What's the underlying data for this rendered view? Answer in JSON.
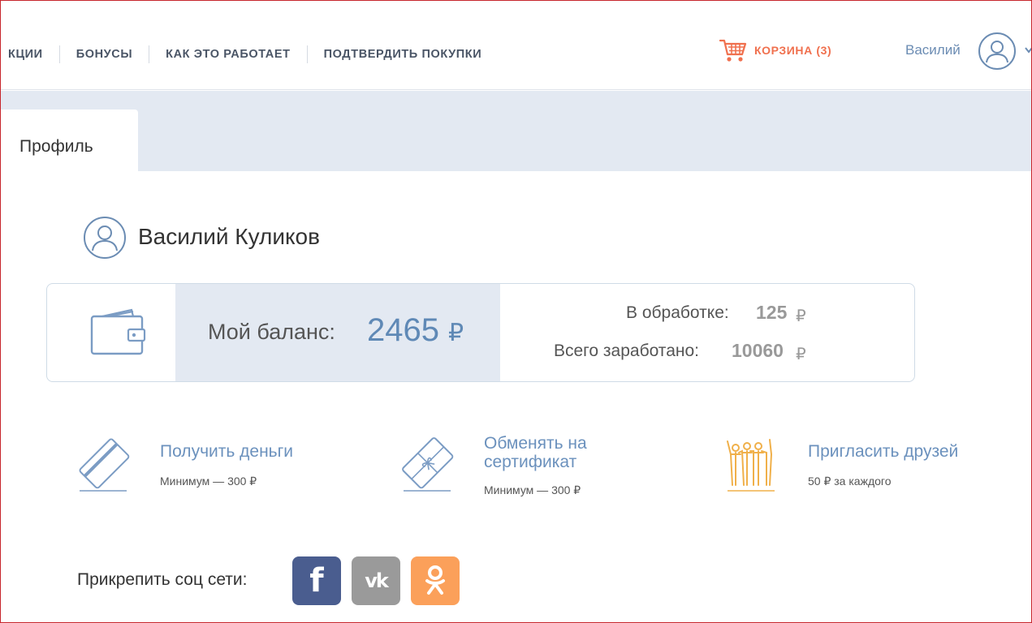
{
  "nav": {
    "items": [
      "АКЦИИ",
      "БОНУСЫ",
      "КАК ЭТО РАБОТАЕТ",
      "ПОДТВЕРДИТЬ ПОКУПКИ"
    ],
    "visible_first_fragment": "КЦИИ"
  },
  "cart": {
    "label": "КОРЗИНА (3)",
    "count": 3,
    "icon": "cart-icon",
    "color": "#f0704e"
  },
  "user": {
    "name": "Василий",
    "icon": "user-avatar-icon"
  },
  "tabs": {
    "active": "Профиль"
  },
  "profile": {
    "full_name": "Василий Куликов"
  },
  "balance": {
    "label": "Мой баланс:",
    "value": "2465",
    "currency": "₽",
    "processing_label": "В обработке:",
    "processing_value": "125",
    "earned_label": "Всего заработано:",
    "earned_value": "10060"
  },
  "actions": [
    {
      "title": "Получить деньги",
      "sub": "Минимум — 300 ₽",
      "icon": "card-icon"
    },
    {
      "title_line1": "Обменять на",
      "title_line2": "сертификат",
      "sub": "Минимум — 300 ₽",
      "icon": "gift-card-icon"
    },
    {
      "title": "Пригласить друзей",
      "sub": "50 ₽ за каждого",
      "icon": "friends-icon"
    }
  ],
  "social": {
    "label": "Прикрепить соц сети:",
    "facebook": "f",
    "vk": "vk",
    "odnoklassniki": "ok"
  },
  "colors": {
    "accent": "#5f89b6",
    "link": "#6b91bd",
    "band": "#e3e9f2",
    "cart": "#f0704e",
    "friends_icon": "#f0b04a",
    "facebook": "#4a5d8f",
    "vk": "#9a9a9a",
    "ok": "#fba05a"
  }
}
